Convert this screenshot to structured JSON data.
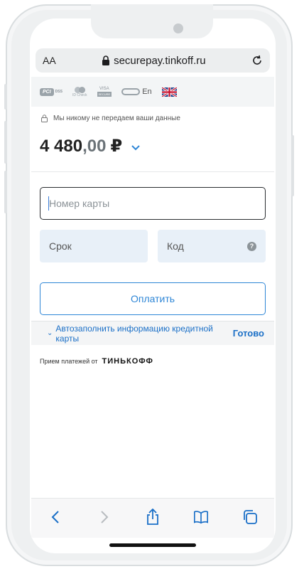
{
  "browser": {
    "text_size_label": "AA",
    "url": "securepay.tinkoff.ru"
  },
  "payment_logos": {
    "pci_dss": "PCI DSS",
    "mastercard": "Mastercard ID Check",
    "visa": "VISA",
    "visa_secure": "SECURE",
    "mir": "Mir Accept",
    "language": "En"
  },
  "privacy_note": "Мы никому не передаем ваши данные",
  "amount": {
    "whole": "4 480",
    "fraction": ",00",
    "currency": "₽"
  },
  "form": {
    "card_number_placeholder": "Номер карты",
    "expiry_placeholder": "Срок",
    "cvc_placeholder": "Код",
    "help_symbol": "?",
    "pay_label": "Оплатить"
  },
  "autofill": {
    "label": "Автозаполнить информацию кредитной карты",
    "done_label": "Готово"
  },
  "merchant": {
    "prefix": "Прием платежей от",
    "brand": "ТИНЬКОФФ"
  },
  "colors": {
    "accent": "#2e86d6",
    "link": "#1a6fc7",
    "input_bg": "#e8f0f8"
  },
  "toolbar_icons": [
    "back-icon",
    "forward-icon",
    "share-icon",
    "bookmarks-icon",
    "tabs-icon"
  ]
}
